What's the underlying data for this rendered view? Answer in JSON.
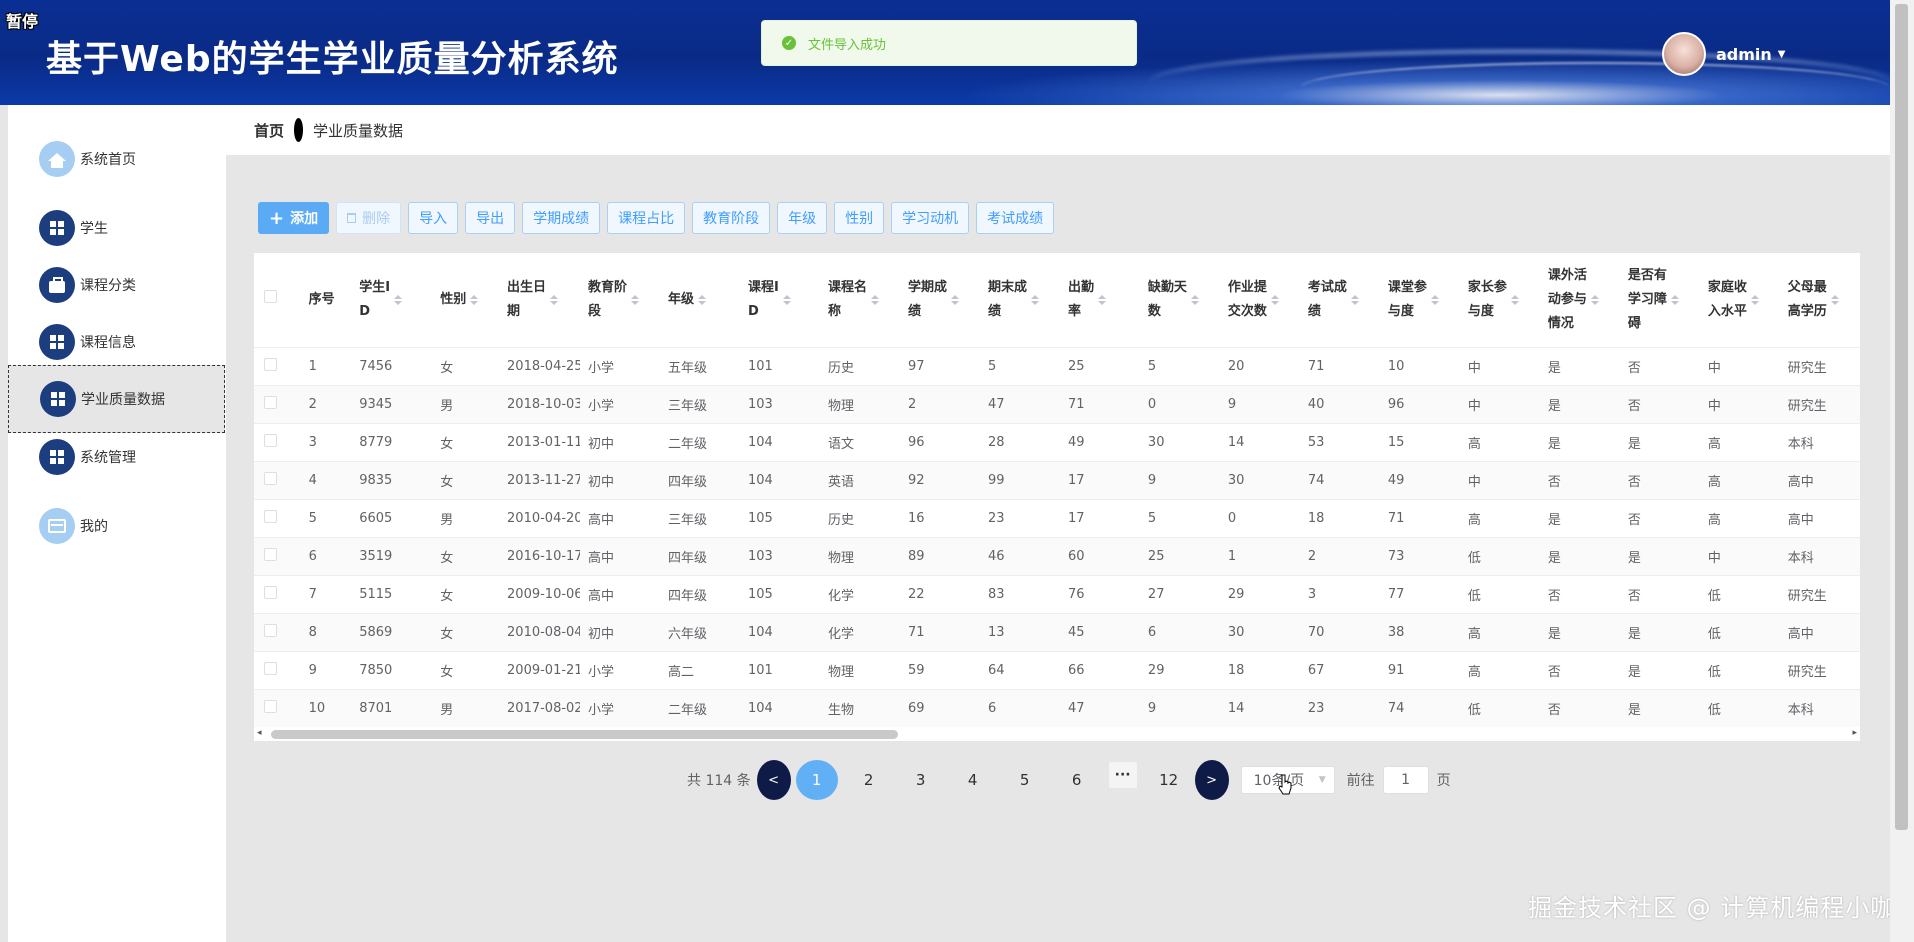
{
  "header": {
    "pause_badge": "暂停",
    "title": "基于Web的学生学业质量分析系统",
    "toast": "文件导入成功",
    "user": "admin",
    "caret": "▼"
  },
  "sidebar": {
    "items": [
      {
        "label": "系统首页",
        "icon": "home-icon"
      },
      {
        "label": "学生",
        "icon": "grid-icon"
      },
      {
        "label": "课程分类",
        "icon": "briefcase-icon"
      },
      {
        "label": "课程信息",
        "icon": "grid-icon"
      },
      {
        "label": "学业质量数据",
        "icon": "grid-icon"
      },
      {
        "label": "系统管理",
        "icon": "grid-icon"
      },
      {
        "label": "我的",
        "icon": "card-icon"
      }
    ]
  },
  "breadcrumb": {
    "home": "首页",
    "current": "学业质量数据"
  },
  "toolbar": {
    "add": "添加",
    "delete": "删除",
    "import": "导入",
    "export": "导出",
    "term_score": "学期成绩",
    "course_ratio": "课程占比",
    "edu_stage": "教育阶段",
    "grade": "年级",
    "gender": "性别",
    "motivation": "学习动机",
    "exam_score": "考试成绩"
  },
  "table": {
    "headers": [
      "序号",
      "学生ID",
      "性别",
      "出生日期",
      "教育阶段",
      "年级",
      "课程ID",
      "课程名称",
      "学期成绩",
      "期末成绩",
      "出勤率",
      "缺勤天数",
      "作业提交次数",
      "考试成绩",
      "课堂参与度",
      "家长参与度",
      "课外活动参与情况",
      "是否有学习障碍",
      "家庭收入水平",
      "父母最高学历"
    ],
    "header_lines": [
      [
        "序号"
      ],
      [
        "学生I",
        "D"
      ],
      [
        "性别"
      ],
      [
        "出生日",
        "期"
      ],
      [
        "教育阶",
        "段"
      ],
      [
        "年级"
      ],
      [
        "课程I",
        "D"
      ],
      [
        "课程名",
        "称"
      ],
      [
        "学期成",
        "绩"
      ],
      [
        "期末成",
        "绩"
      ],
      [
        "出勤",
        "率"
      ],
      [
        "缺勤天",
        "数"
      ],
      [
        "作业提",
        "交次数"
      ],
      [
        "考试成",
        "绩"
      ],
      [
        "课堂参",
        "与度"
      ],
      [
        "家长参",
        "与度"
      ],
      [
        "课外活",
        "动参与",
        "情况"
      ],
      [
        "是否有",
        "学习障",
        "碍"
      ],
      [
        "家庭收",
        "入水平"
      ],
      [
        "父母最",
        "高学历"
      ]
    ],
    "rows": [
      [
        "1",
        "7456",
        "女",
        "2018-04-25",
        "小学",
        "五年级",
        "101",
        "历史",
        "97",
        "5",
        "25",
        "5",
        "20",
        "71",
        "10",
        "中",
        "是",
        "否",
        "中",
        "研究生"
      ],
      [
        "2",
        "9345",
        "男",
        "2018-10-03",
        "小学",
        "三年级",
        "103",
        "物理",
        "2",
        "47",
        "71",
        "0",
        "9",
        "40",
        "96",
        "中",
        "是",
        "否",
        "中",
        "研究生"
      ],
      [
        "3",
        "8779",
        "女",
        "2013-01-11",
        "初中",
        "二年级",
        "104",
        "语文",
        "96",
        "28",
        "49",
        "30",
        "14",
        "53",
        "15",
        "高",
        "是",
        "是",
        "高",
        "本科"
      ],
      [
        "4",
        "9835",
        "女",
        "2013-11-27",
        "初中",
        "四年级",
        "104",
        "英语",
        "92",
        "99",
        "17",
        "9",
        "30",
        "74",
        "49",
        "中",
        "否",
        "否",
        "高",
        "高中"
      ],
      [
        "5",
        "6605",
        "男",
        "2010-04-20",
        "高中",
        "三年级",
        "105",
        "历史",
        "16",
        "23",
        "17",
        "5",
        "0",
        "18",
        "71",
        "高",
        "是",
        "否",
        "高",
        "高中"
      ],
      [
        "6",
        "3519",
        "女",
        "2016-10-17",
        "高中",
        "四年级",
        "103",
        "物理",
        "89",
        "46",
        "60",
        "25",
        "1",
        "2",
        "73",
        "低",
        "是",
        "是",
        "中",
        "本科"
      ],
      [
        "7",
        "5115",
        "女",
        "2009-10-06",
        "高中",
        "四年级",
        "105",
        "化学",
        "22",
        "83",
        "76",
        "27",
        "29",
        "3",
        "77",
        "低",
        "否",
        "否",
        "低",
        "研究生"
      ],
      [
        "8",
        "5869",
        "女",
        "2010-08-04",
        "初中",
        "六年级",
        "104",
        "化学",
        "71",
        "13",
        "45",
        "6",
        "30",
        "70",
        "38",
        "高",
        "是",
        "是",
        "低",
        "高中"
      ],
      [
        "9",
        "7850",
        "女",
        "2009-01-21",
        "小学",
        "高二",
        "101",
        "物理",
        "59",
        "64",
        "66",
        "29",
        "18",
        "67",
        "91",
        "高",
        "否",
        "是",
        "低",
        "研究生"
      ],
      [
        "10",
        "8701",
        "男",
        "2017-08-02",
        "小学",
        "二年级",
        "104",
        "生物",
        "69",
        "6",
        "47",
        "9",
        "14",
        "23",
        "74",
        "低",
        "否",
        "是",
        "低",
        "本科"
      ]
    ]
  },
  "pagination": {
    "total": "共 114 条",
    "prev": "<",
    "next": ">",
    "pages": [
      "1",
      "2",
      "3",
      "4",
      "5",
      "6"
    ],
    "more": "···",
    "last": "12",
    "current": "1",
    "size": "10条/页",
    "goto_label": "前往",
    "goto_value": "1",
    "goto_suffix": "页"
  },
  "watermark": "掘金技术社区 @ 计算机编程小咖"
}
